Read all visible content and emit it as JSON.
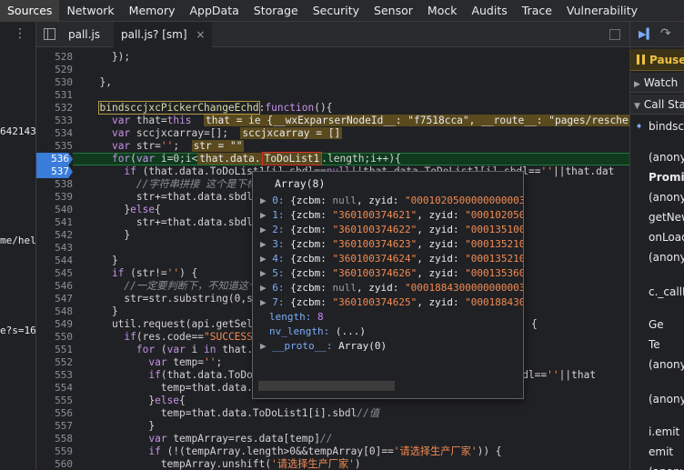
{
  "top_tabs": [
    "Sources",
    "Network",
    "Memory",
    "AppData",
    "Storage",
    "Security",
    "Sensor",
    "Mock",
    "Audits",
    "Trace",
    "Vulnerability"
  ],
  "left_panel": {
    "texts": [
      "642143",
      "me/hel",
      "e?s=16"
    ]
  },
  "file_tabs": [
    {
      "label": "pall.js"
    },
    {
      "label": "pall.js? [sm]",
      "close": "×"
    }
  ],
  "editor": {
    "lines": [
      {
        "n": "528",
        "code": "    });"
      },
      {
        "n": "529",
        "code": ""
      },
      {
        "n": "530",
        "code": "  },"
      },
      {
        "n": "531",
        "code": ""
      },
      {
        "n": "532",
        "code": "  bindsccjxcPickerChangeEchd:function(){"
      },
      {
        "n": "533",
        "code": "    var that=this"
      },
      {
        "n": "534",
        "code": "    var sccjxcarray=[];"
      },
      {
        "n": "535",
        "code": "    var str='';"
      },
      {
        "n": "536",
        "code": "    for(var i=0;i<that.data.ToDoList1.length;i++){"
      },
      {
        "n": "537",
        "code": "      if (that.data.ToDoList1[i].sbdl==null||that.data.ToDoList1[i].sbdl==''||that.dat"
      },
      {
        "n": "538",
        "code": "        //字符串拼接 这个是下标"
      },
      {
        "n": "539",
        "code": "        str+=that.data.sbdlxc"
      },
      {
        "n": "540",
        "code": "      }else{"
      },
      {
        "n": "541",
        "code": "        str+=that.data.sbdlxc"
      },
      {
        "n": "542",
        "code": "      }"
      },
      {
        "n": "543",
        "code": ""
      },
      {
        "n": "544",
        "code": "    }"
      },
      {
        "n": "545",
        "code": "    if (str!='') {"
      },
      {
        "n": "546",
        "code": "      //一定要判断下，不知道这个"
      },
      {
        "n": "547",
        "code": "      str=str.substring(0,str"
      },
      {
        "n": "548",
        "code": "    }"
      },
      {
        "n": "549",
        "code": "    util.request(api.getSelect"
      },
      {
        "n": "550",
        "code": "      if(res.code==\"SUCCESS\"){"
      },
      {
        "n": "551",
        "code": "        for (var i in that.dat"
      },
      {
        "n": "552",
        "code": "          var temp='';"
      },
      {
        "n": "553",
        "code": "          if(that.data.ToDoLi"
      },
      {
        "n": "554",
        "code": "            temp=that.data.sbd"
      },
      {
        "n": "555",
        "code": "          }else{"
      },
      {
        "n": "556",
        "code": "            temp=that.data.ToDoList1[i].sbdl//值"
      },
      {
        "n": "557",
        "code": "          }"
      },
      {
        "n": "558",
        "code": "          var tempArray=res.data[temp]//"
      },
      {
        "n": "559",
        "code": "          if (!(tempArray.length>0&&tempArray[0]=='请选择生产厂家')) {"
      },
      {
        "n": "560",
        "code": "            tempArray.unshift('请选择生产厂家')"
      }
    ],
    "inline_values": {
      "l533": "that = ie {__wxExparserNodeId__: \"f7518cca\", __route__: \"pages/rescheck",
      "l534": "sccjxcarray = []",
      "l535": "str = \"\""
    },
    "tails": {
      "l549": "{",
      "l553": ".sbdl==''||that"
    }
  },
  "popover": {
    "title": "Array(8)",
    "rows": [
      {
        "idx": "0",
        "zcbm": "null",
        "zyid": "\"00010205000000000032"
      },
      {
        "idx": "1",
        "zcbm": "\"360100374621\"",
        "zyid": "\"000102050"
      },
      {
        "idx": "2",
        "zcbm": "\"360100374622\"",
        "zyid": "\"000135100"
      },
      {
        "idx": "3",
        "zcbm": "\"360100374623\"",
        "zyid": "\"000135210"
      },
      {
        "idx": "4",
        "zcbm": "\"360100374624\"",
        "zyid": "\"000135210"
      },
      {
        "idx": "5",
        "zcbm": "\"360100374626\"",
        "zyid": "\"000135360"
      },
      {
        "idx": "6",
        "zcbm": "null",
        "zyid": "\"00018843000000000030"
      },
      {
        "idx": "7",
        "zcbm": "\"360100374625\"",
        "zyid": "\"000188430"
      }
    ],
    "length_label": "length:",
    "length_value": "8",
    "nv_length_label": "nv_length:",
    "nv_length_value": "(...)",
    "proto_label": "__proto__:",
    "proto_value": "Array(0)"
  },
  "right_panel": {
    "paused_label": "Paused",
    "watch_label": "Watch",
    "callstack_label": "Call Stac",
    "frames": [
      "bindsccj",
      "(anonym",
      "Promis",
      "(anonym",
      "getNew",
      "onLoad",
      "(anonym",
      "c._callP",
      "Ge",
      "Te",
      "(anonym",
      "(anonym",
      "i.emit",
      "emit",
      "(anonym"
    ]
  },
  "colors": {
    "accent_blue": "#3a7cd9",
    "exec_line": "#0f3a1e",
    "paused_yellow": "#f0c040",
    "string_orange": "#f28b54"
  }
}
